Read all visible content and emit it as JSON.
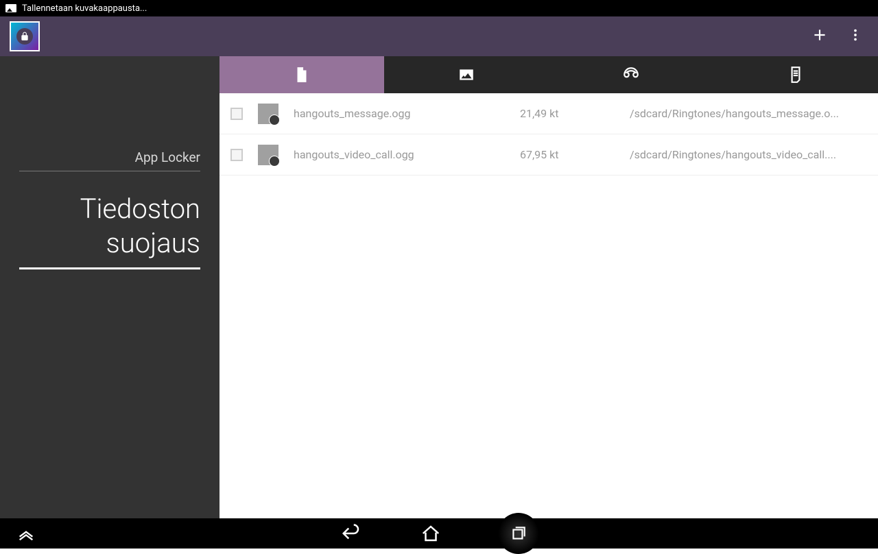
{
  "status": {
    "text": "Tallennetaan kuvakaappausta..."
  },
  "sidebar": {
    "item1": "App Locker",
    "item2": "Tiedoston suojaus"
  },
  "files": [
    {
      "name": "hangouts_message.ogg",
      "size": "21,49 kt",
      "path": "/sdcard/Ringtones/hangouts_message.o..."
    },
    {
      "name": "hangouts_video_call.ogg",
      "size": "67,95 kt",
      "path": "/sdcard/Ringtones/hangouts_video_call...."
    }
  ]
}
